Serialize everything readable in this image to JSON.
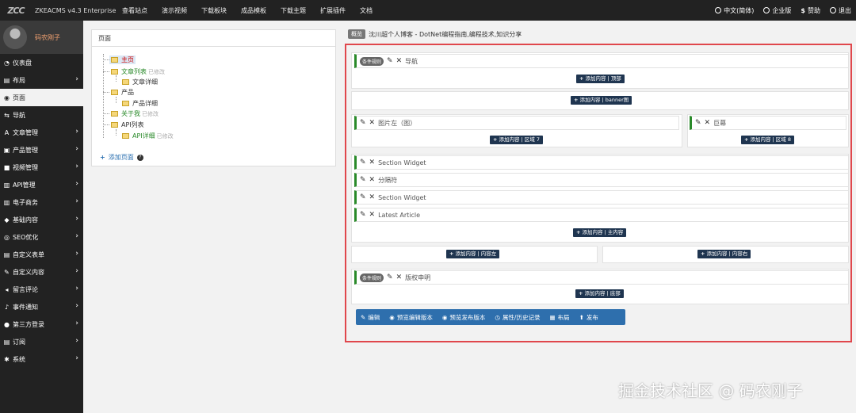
{
  "topbar": {
    "logo": "ZCC",
    "brand": "ZKEACMS v4.3 Enterprise",
    "nav": [
      "查看站点",
      "演示视频",
      "下载板块",
      "成品模板",
      "下载主题",
      "扩展插件",
      "文档"
    ],
    "right": [
      {
        "icon": "globe-icon",
        "label": "中文(简体)"
      },
      {
        "icon": "enterprise-icon",
        "label": "企业版"
      },
      {
        "icon": "dollar-icon",
        "label": "赞助"
      },
      {
        "icon": "power-icon",
        "label": "退出"
      }
    ]
  },
  "sidebar": {
    "username": "码农刚子",
    "items": [
      {
        "icon": "dashboard-icon",
        "label": "仪表盘",
        "chevron": false
      },
      {
        "icon": "layout-icon",
        "label": "布局",
        "chevron": true
      },
      {
        "icon": "eye-icon",
        "label": "页面",
        "chevron": false,
        "active": true
      },
      {
        "icon": "nav-icon",
        "label": "导航",
        "chevron": false
      },
      {
        "icon": "article-icon",
        "label": "文章管理",
        "chevron": true
      },
      {
        "icon": "product-icon",
        "label": "产品管理",
        "chevron": true
      },
      {
        "icon": "video-icon",
        "label": "视频管理",
        "chevron": true
      },
      {
        "icon": "api-icon",
        "label": "API管理",
        "chevron": true
      },
      {
        "icon": "cart-icon",
        "label": "电子商务",
        "chevron": true
      },
      {
        "icon": "content-icon",
        "label": "基础内容",
        "chevron": true
      },
      {
        "icon": "search-icon",
        "label": "SEO优化",
        "chevron": true
      },
      {
        "icon": "form-icon",
        "label": "自定义表单",
        "chevron": true
      },
      {
        "icon": "edit-icon",
        "label": "自定义内容",
        "chevron": true
      },
      {
        "icon": "comment-icon",
        "label": "留言评论",
        "chevron": true
      },
      {
        "icon": "bell-icon",
        "label": "事件通知",
        "chevron": true
      },
      {
        "icon": "user-icon",
        "label": "第三方登录",
        "chevron": true
      },
      {
        "icon": "subscribe-icon",
        "label": "订阅",
        "chevron": true
      },
      {
        "icon": "gear-icon",
        "label": "系统",
        "chevron": true
      }
    ]
  },
  "pages_panel": {
    "title": "页面",
    "tree": [
      {
        "label": "主页",
        "note": ""
      },
      {
        "label": "文章列表",
        "note": "已修改"
      },
      {
        "label": "文章详细",
        "note": ""
      },
      {
        "label": "产品",
        "note": ""
      },
      {
        "label": "产品详细",
        "note": ""
      },
      {
        "label": "关于我",
        "note": "已修改"
      },
      {
        "label": "API列表",
        "note": ""
      },
      {
        "label": "API详细",
        "note": "已修改"
      }
    ],
    "add_page": "添加页面"
  },
  "breadcrumb": {
    "badge": "概览",
    "text": "沈川超个人博客 - DotNet编程指南,编程技术,知识分享"
  },
  "editor": {
    "tag": "条件规则",
    "widgets": {
      "nav": "导航",
      "img_left": "图片左（图）",
      "banner": "巨幕",
      "section1": "Section Widget",
      "divider": "分隔符",
      "section2": "Section Widget",
      "latest": "Latest Article",
      "copyright": "版权申明"
    },
    "buttons": {
      "top": "添加内容 | 顶部",
      "banner": "添加内容 | banner图",
      "zone7": "添加内容 | 区域 7",
      "zone8": "添加内容 | 区域 8",
      "main": "添加内容 | 主内容",
      "left": "添加内容 | 内容左",
      "right": "添加内容 | 内容右",
      "bottom": "添加内容 | 底部"
    },
    "toolbar": [
      {
        "icon": "pencil-icon",
        "label": "编辑"
      },
      {
        "icon": "eye-icon",
        "label": "预览编辑版本"
      },
      {
        "icon": "eye-icon",
        "label": "预览发布版本"
      },
      {
        "icon": "history-icon",
        "label": "属性/历史记录"
      },
      {
        "icon": "grid-icon",
        "label": "布局"
      },
      {
        "icon": "publish-icon",
        "label": "发布"
      }
    ]
  },
  "watermark": "掘金技术社区 @ 码农刚子"
}
